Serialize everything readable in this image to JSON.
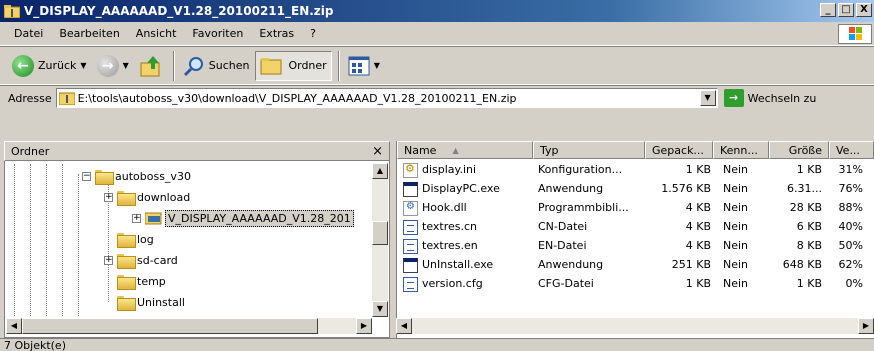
{
  "window": {
    "title": "V_DISPLAY_AAAAAAD_V1.28_20100211_EN.zip",
    "minimize": "_",
    "maximize": "□",
    "close": "X"
  },
  "menu": [
    "Datei",
    "Bearbeiten",
    "Ansicht",
    "Favoriten",
    "Extras",
    "?"
  ],
  "toolbar": {
    "back_label": "Zurück",
    "search_label": "Suchen",
    "folders_label": "Ordner"
  },
  "address": {
    "label": "Adresse",
    "value": "E:\\tools\\autoboss_v30\\download\\V_DISPLAY_AAAAAAD_V1.28_20100211_EN.zip",
    "go_label": "Wechseln zu"
  },
  "folder_pane": {
    "title": "Ordner",
    "close": "×",
    "tree": [
      {
        "label": "autoboss_v30",
        "toggle": "−"
      },
      {
        "label": "download",
        "toggle": "+"
      },
      {
        "label": "V_DISPLAY_AAAAAAD_V1.28_201",
        "toggle": "+"
      },
      {
        "label": "log",
        "toggle": ""
      },
      {
        "label": "sd-card",
        "toggle": "+"
      },
      {
        "label": "temp",
        "toggle": ""
      },
      {
        "label": "Uninstall",
        "toggle": ""
      }
    ]
  },
  "file_list": {
    "columns": [
      "Name",
      "Typ",
      "Gepack...",
      "Kenn...",
      "Größe",
      "Ve..."
    ],
    "sort_indicator": "▲",
    "rows": [
      {
        "icon": "ini-file-icon",
        "name": "display.ini",
        "type": "Konfiguration...",
        "packed": "1 KB",
        "protected": "Nein",
        "size": "1 KB",
        "ratio": "31%"
      },
      {
        "icon": "exe-file-icon",
        "name": "DisplayPC.exe",
        "type": "Anwendung",
        "packed": "1.576 KB",
        "protected": "Nein",
        "size": "6.31...",
        "ratio": "76%"
      },
      {
        "icon": "dll-file-icon",
        "name": "Hook.dll",
        "type": "Programmbibli...",
        "packed": "4 KB",
        "protected": "Nein",
        "size": "28 KB",
        "ratio": "88%"
      },
      {
        "icon": "text-file-icon",
        "name": "textres.cn",
        "type": "CN-Datei",
        "packed": "4 KB",
        "protected": "Nein",
        "size": "6 KB",
        "ratio": "40%"
      },
      {
        "icon": "text-file-icon",
        "name": "textres.en",
        "type": "EN-Datei",
        "packed": "4 KB",
        "protected": "Nein",
        "size": "8 KB",
        "ratio": "50%"
      },
      {
        "icon": "exe-file-icon",
        "name": "UnInstall.exe",
        "type": "Anwendung",
        "packed": "251 KB",
        "protected": "Nein",
        "size": "648 KB",
        "ratio": "62%"
      },
      {
        "icon": "text-file-icon",
        "name": "version.cfg",
        "type": "CFG-Datei",
        "packed": "1 KB",
        "protected": "Nein",
        "size": "1 KB",
        "ratio": "0%"
      }
    ]
  },
  "status": {
    "text": "7 Objekt(e)"
  }
}
